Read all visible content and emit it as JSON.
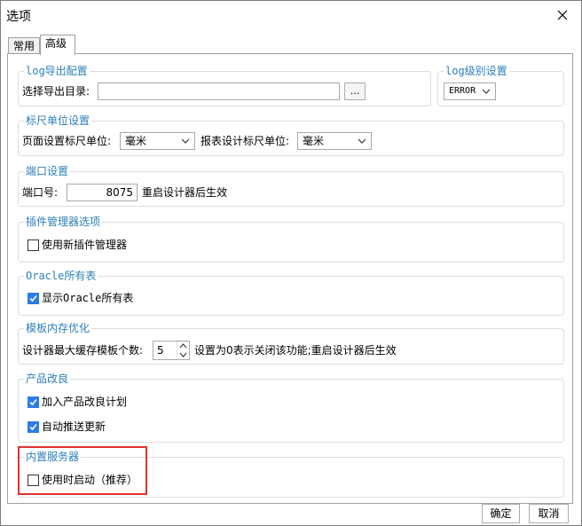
{
  "window": {
    "title": "选项"
  },
  "tabs": [
    {
      "label": "常用"
    },
    {
      "label": "高级"
    }
  ],
  "log_export": {
    "title": "log导出配置",
    "dir_label": "选择导出目录:",
    "dir_value": "",
    "browse_label": "..."
  },
  "log_level": {
    "title": "log级别设置",
    "value": "ERROR"
  },
  "ruler": {
    "title": "标尺单位设置",
    "page_label": "页面设置标尺单位:",
    "page_value": "毫米",
    "report_label": "报表设计标尺单位:",
    "report_value": "毫米"
  },
  "port": {
    "title": "端口设置",
    "label": "端口号:",
    "value": "8075",
    "note": "重启设计器后生效"
  },
  "plugin": {
    "title": "插件管理器选项",
    "checkbox_label": "使用新插件管理器",
    "checked": false
  },
  "oracle": {
    "title": "Oracle所有表",
    "checkbox_label": "显示Oracle所有表",
    "checked": true
  },
  "template_mem": {
    "title": "模板内存优化",
    "label": "设计器最大缓存模板个数:",
    "value": "5",
    "note": "设置为0表示关闭该功能;重启设计器后生效"
  },
  "improve": {
    "title": "产品改良",
    "join_label": "加入产品改良计划",
    "join_checked": true,
    "push_label": "自动推送更新",
    "push_checked": true
  },
  "server": {
    "title": "内置服务器",
    "checkbox_label": "使用时启动（推荐）",
    "checked": false
  },
  "footer": {
    "ok_label": "确定",
    "cancel_label": "取消"
  }
}
